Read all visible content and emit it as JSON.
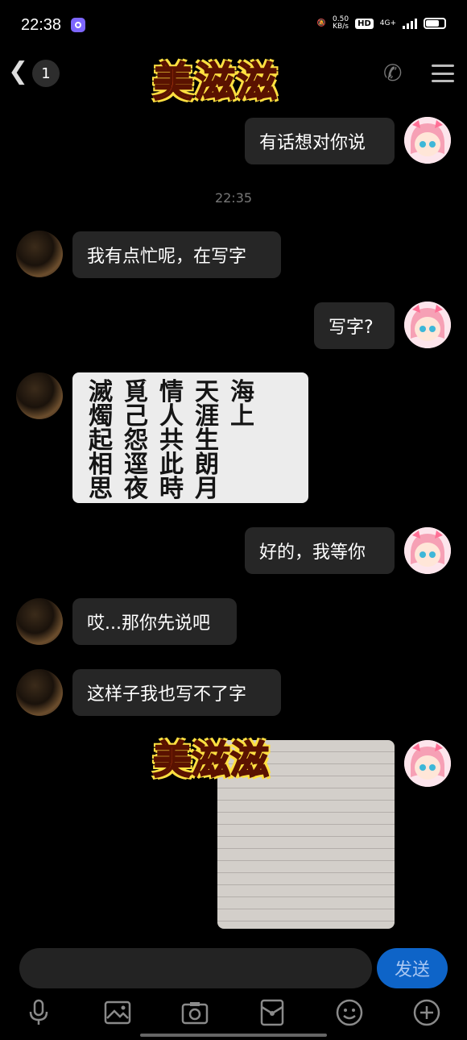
{
  "status": {
    "time": "22:38",
    "net_speed": "0.50",
    "net_unit": "KB/s",
    "hd": "HD",
    "signal": "4G+"
  },
  "nav": {
    "badge_count": "1",
    "logo_text": "美滋滋"
  },
  "messages": {
    "m1": "有话想对你说",
    "timestamp": "22:35",
    "m2": "我有点忙呢，在写字",
    "m3": "写字?",
    "calligraphy_lines": [
      "滅覓情天海",
      "燭己人涯上",
      "起怨共生",
      "相逕此朗",
      "思夜時月"
    ],
    "m4": "好的，我等你",
    "m5": "哎...那你先说吧",
    "m6": "这样子我也写不了字"
  },
  "input": {
    "send_label": "发送"
  },
  "icons": [
    "mic-icon",
    "image-icon",
    "camera-icon",
    "red-packet-icon",
    "emoji-icon",
    "plus-icon"
  ]
}
